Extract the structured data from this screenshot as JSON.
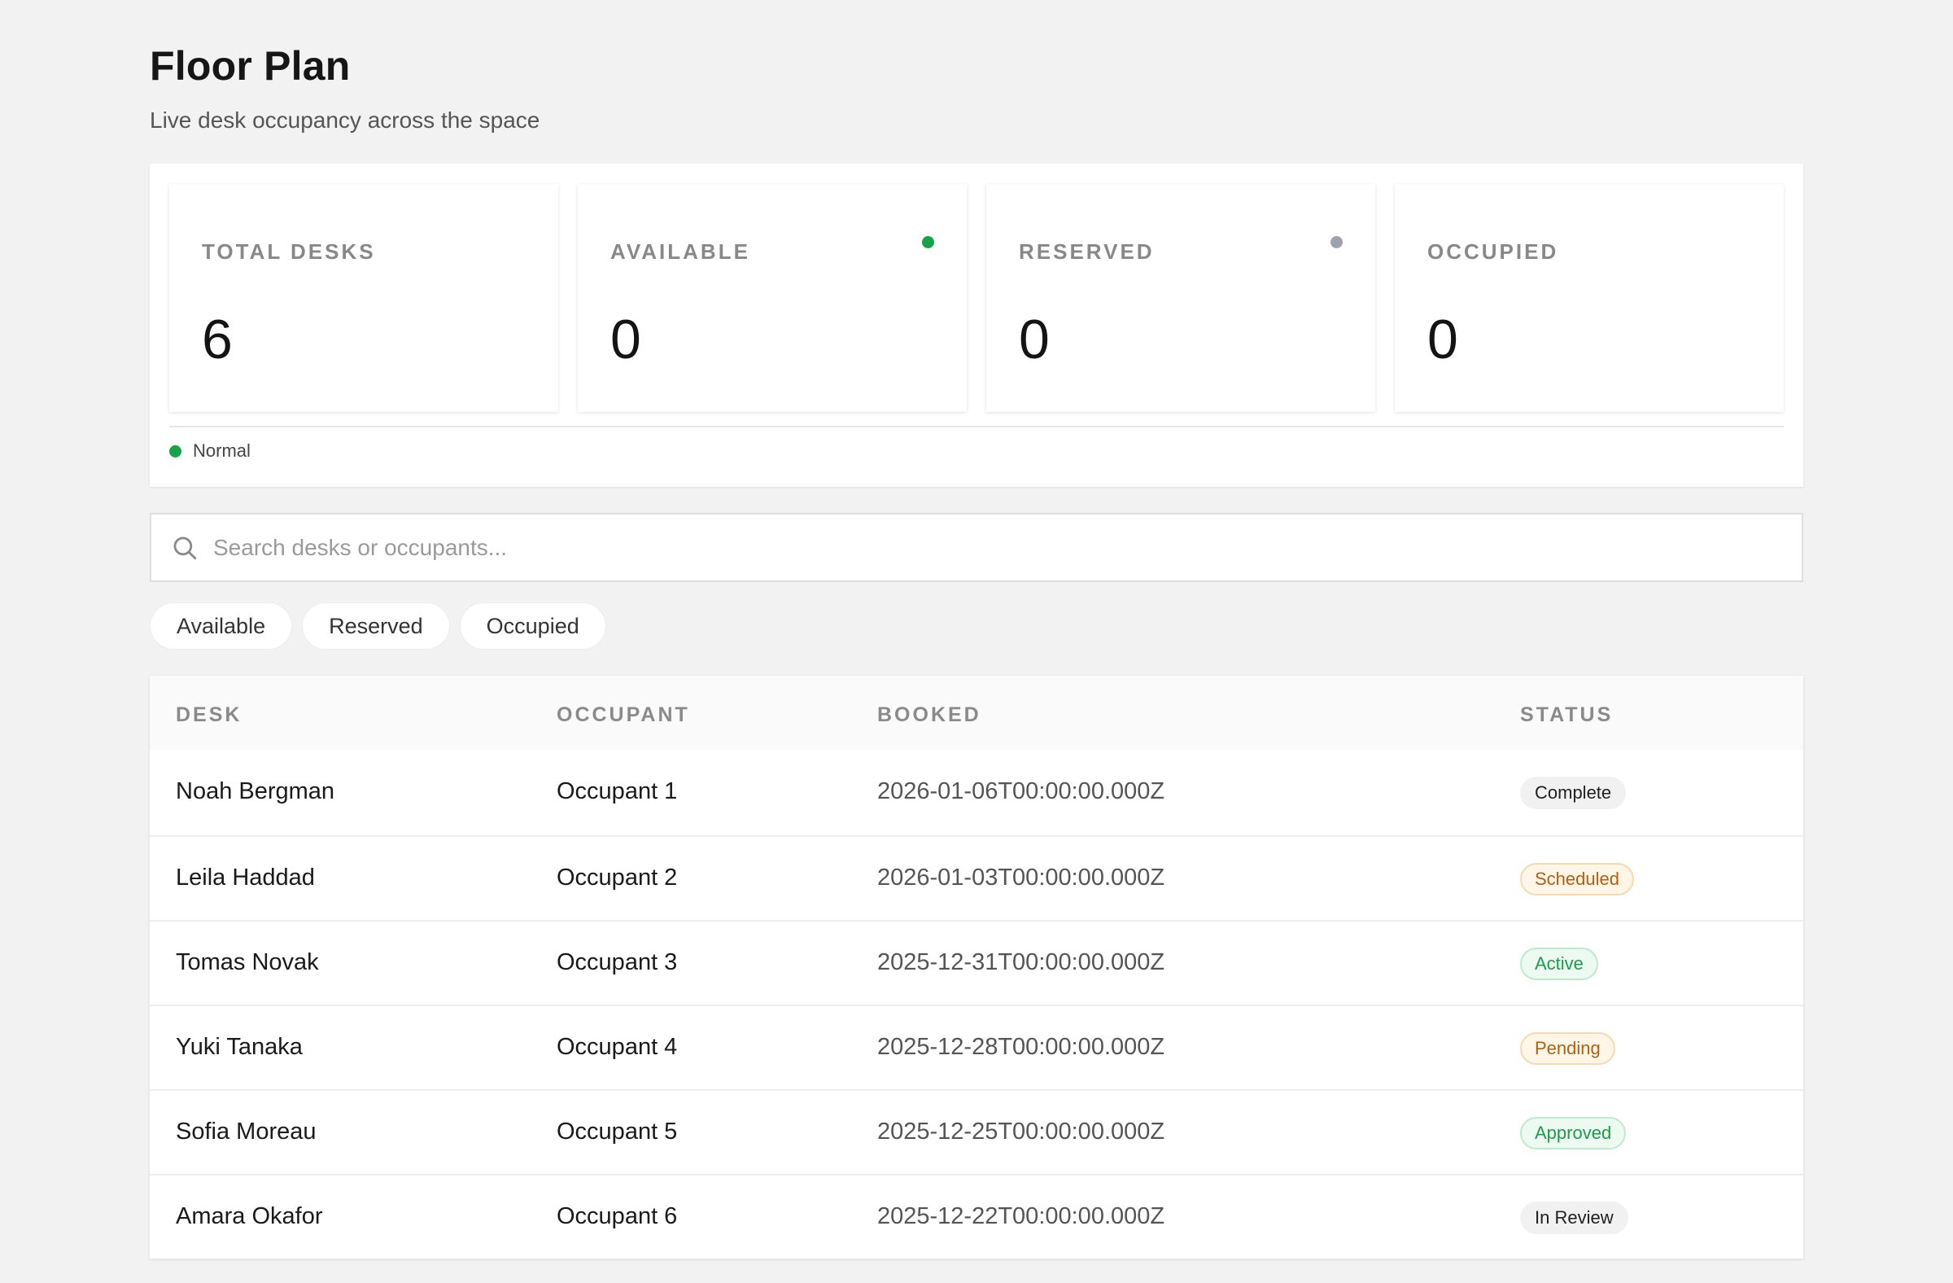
{
  "header": {
    "title": "Floor Plan",
    "subtitle": "Live desk occupancy across the space"
  },
  "stats": [
    {
      "label": "TOTAL DESKS",
      "value": "6",
      "dot_color": null
    },
    {
      "label": "AVAILABLE",
      "value": "0",
      "dot_color": "#16a34a"
    },
    {
      "label": "RESERVED",
      "value": "0",
      "dot_color": "#9ca3af"
    },
    {
      "label": "OCCUPIED",
      "value": "0",
      "dot_color": null
    }
  ],
  "legend": {
    "label": "Normal",
    "color": "#16a34a"
  },
  "search": {
    "placeholder": "Search desks or occupants...",
    "value": ""
  },
  "filters": [
    "Available",
    "Reserved",
    "Occupied"
  ],
  "table": {
    "columns": [
      "DESK",
      "OCCUPANT",
      "BOOKED",
      "STATUS"
    ],
    "rows": [
      {
        "desk": "Noah Bergman",
        "occupant": "Occupant 1",
        "booked": "2026-01-06T00:00:00.000Z",
        "status": "Complete",
        "tone": "neutral"
      },
      {
        "desk": "Leila Haddad",
        "occupant": "Occupant 2",
        "booked": "2026-01-03T00:00:00.000Z",
        "status": "Scheduled",
        "tone": "orange"
      },
      {
        "desk": "Tomas Novak",
        "occupant": "Occupant 3",
        "booked": "2025-12-31T00:00:00.000Z",
        "status": "Active",
        "tone": "green"
      },
      {
        "desk": "Yuki Tanaka",
        "occupant": "Occupant 4",
        "booked": "2025-12-28T00:00:00.000Z",
        "status": "Pending",
        "tone": "orange"
      },
      {
        "desk": "Sofia Moreau",
        "occupant": "Occupant 5",
        "booked": "2025-12-25T00:00:00.000Z",
        "status": "Approved",
        "tone": "green"
      },
      {
        "desk": "Amara Okafor",
        "occupant": "Occupant 6",
        "booked": "2025-12-22T00:00:00.000Z",
        "status": "In Review",
        "tone": "neutral"
      }
    ]
  },
  "colors": {
    "background": "#f2f2f2",
    "green": "#16a34a",
    "gray_dot": "#9ca3af",
    "orange_text": "#b25f12"
  }
}
